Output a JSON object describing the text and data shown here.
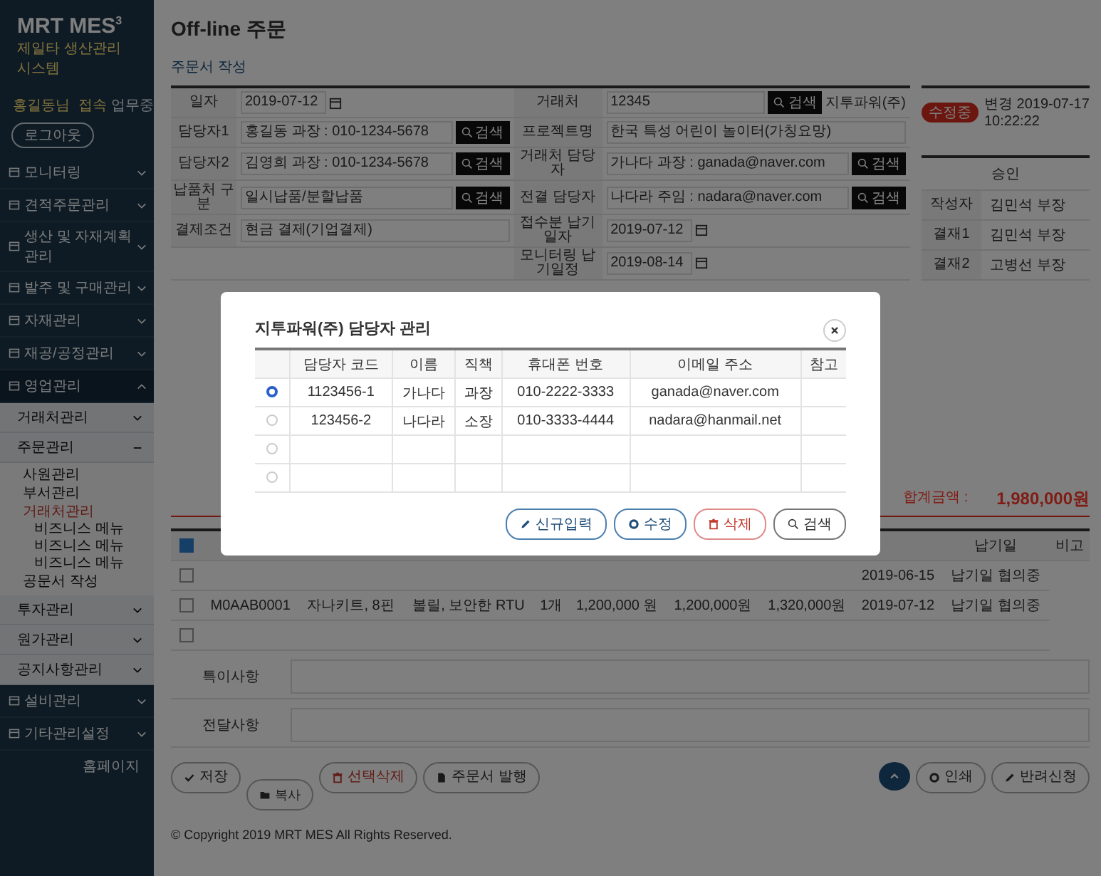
{
  "sidebar": {
    "logo": "MRT MES",
    "logo_sup": "3",
    "subtitle": "제일타 생산관리 시스템",
    "user": "홍길동님",
    "status": "접속",
    "status_extra": "업무중",
    "logout": "로그아웃",
    "menu": [
      {
        "label": "모니터링",
        "expanded": false
      },
      {
        "label": "견적주문관리",
        "expanded": false
      },
      {
        "label": "생산 및 자재계획관리",
        "expanded": false
      },
      {
        "label": "발주 및 구매관리",
        "expanded": false
      },
      {
        "label": "자재관리",
        "expanded": false
      },
      {
        "label": "재공/공정관리",
        "expanded": false
      },
      {
        "label": "영업관리",
        "expanded": true,
        "children": [
          {
            "label": "거래처관리",
            "expanded": false
          },
          {
            "label": "주문관리",
            "expanded": true,
            "children": [
              {
                "label": "사원관리",
                "selected": false
              },
              {
                "label": "부서관리",
                "selected": false
              },
              {
                "label": "거래처관리",
                "selected": true,
                "children": [
                  {
                    "label": "비즈니스 메뉴"
                  },
                  {
                    "label": "비즈니스 메뉴"
                  },
                  {
                    "label": "비즈니스 메뉴"
                  }
                ]
              },
              {
                "label": "공문서 작성",
                "selected": false
              }
            ]
          },
          {
            "label": "투자관리",
            "expanded": false
          },
          {
            "label": "원가관리",
            "expanded": false
          },
          {
            "label": "공지사항관리",
            "expanded": false
          }
        ]
      },
      {
        "label": "설비관리",
        "expanded": false
      },
      {
        "label": "기타관리설정",
        "expanded": false
      }
    ],
    "footer_link": "홈페이지"
  },
  "page": {
    "title": "Off-line 주문",
    "section": "주문서 작성"
  },
  "form": {
    "rows": [
      {
        "left": {
          "label": "일자",
          "kind": "date",
          "value": "2019-07-12"
        },
        "right": {
          "label": "거래처",
          "kind": "search",
          "value": "12345",
          "button": "검색",
          "note": "지투파워(주)"
        }
      },
      {
        "left": {
          "label": "담당자1",
          "kind": "search",
          "value": "홍길동 과장 : 010-1234-5678",
          "button": "검색"
        },
        "right": {
          "label": "프로젝트명",
          "kind": "text",
          "value": "한국 특성 어린이 놀이터(가칭요망)"
        }
      },
      {
        "left": {
          "label": "담당자2",
          "kind": "search",
          "value": "김영희 과장 : 010-1234-5678",
          "button": "검색"
        },
        "right": {
          "label": "거래처 담당자",
          "kind": "search",
          "value": "가나다 과장 : ganada@naver.com",
          "button": "검색"
        }
      },
      {
        "left": {
          "label": "납품처 구분",
          "kind": "search",
          "value": "일시납품/분할납품",
          "button": "검색"
        },
        "right": {
          "label": "전결 담당자",
          "kind": "search",
          "value": "나다라 주임 : nadara@naver.com",
          "button": "검색"
        }
      },
      {
        "left": {
          "label": "결제조건",
          "kind": "text",
          "value": "현금 결제(기업결제)"
        },
        "right": {
          "label": "접수분 납기일자",
          "kind": "date",
          "value": "2019-07-12"
        }
      },
      {
        "left": {
          "kind": "blank"
        },
        "right": {
          "label": "모니터링 납기일정",
          "kind": "date",
          "value": "2019-08-14"
        }
      }
    ]
  },
  "status": {
    "badge": "수정중",
    "changed": "변경 2019-07-17 10:22:22"
  },
  "approval": {
    "title": "승인",
    "rows": [
      {
        "role": "작성자",
        "name": "김민석 부장"
      },
      {
        "role": "결재1",
        "name": "김민석 부장"
      },
      {
        "role": "결재2",
        "name": "고병선 부장"
      }
    ]
  },
  "total": {
    "label": "합계금액 :",
    "value": "1,980,000원"
  },
  "items": {
    "all_checked": true,
    "columns": [
      {},
      {},
      {},
      {},
      {},
      {},
      {},
      {},
      {
        "label": "납기일"
      },
      {
        "label": "비고"
      }
    ],
    "rows": [
      {
        "checked": false,
        "cells": [
          {},
          {},
          {},
          {},
          {},
          {},
          {},
          {
            "text": "2019-06-15"
          },
          {
            "text": "납기일 협의중"
          }
        ]
      },
      {
        "checked": false,
        "cells": [
          {
            "text": "M0AAB0001"
          },
          {
            "text": "자나키트, 8핀"
          },
          {
            "text": "볼릴, 보안한 RTU"
          },
          {
            "text": "1개"
          },
          {
            "text": "1,200,000 원"
          },
          {
            "text": "1,200,000원"
          },
          {
            "text": "1,320,000원"
          },
          {
            "text": "2019-07-12"
          },
          {
            "text": "납기일 협의중"
          }
        ]
      },
      {
        "checked": false,
        "cells": [
          {},
          {},
          {},
          {},
          {},
          {},
          {},
          {},
          {}
        ]
      }
    ]
  },
  "notes": [
    {
      "label": "특이사항"
    },
    {
      "label": "전달사항"
    }
  ],
  "actions": {
    "left": [
      {
        "label": "저장",
        "kind": "save"
      },
      {
        "label": "복사",
        "kind": "copy"
      },
      {
        "label": "선택삭제",
        "kind": "delete"
      },
      {
        "label": "주문서 발행",
        "kind": "publish"
      }
    ],
    "right": [
      {
        "label": "인쇄",
        "kind": "print"
      },
      {
        "label": "반려신청",
        "kind": "edit"
      }
    ]
  },
  "copyright": "© Copyright 2019 MRT MES All Rights Reserved.",
  "modal": {
    "title": "지투파워(주) 담당자 관리",
    "columns": [
      {
        "label": "담당자 코드"
      },
      {
        "label": "이름"
      },
      {
        "label": "직책"
      },
      {
        "label": "휴대폰 번호"
      },
      {
        "label": "이메일 주소"
      },
      {
        "label": "참고"
      }
    ],
    "rows": [
      {
        "selected": true,
        "code": "1123456-1",
        "name": "가나다",
        "position": "과장",
        "phone": "010-2222-3333",
        "email": "ganada@naver.com"
      },
      {
        "selected": false,
        "code": "123456-2",
        "name": "나다라",
        "position": "소장",
        "phone": "010-3333-4444",
        "email": "nadara@hanmail.net"
      },
      {
        "selected": false
      },
      {
        "selected": false
      }
    ],
    "buttons": [
      {
        "label": "신규입력",
        "kind": "new"
      },
      {
        "label": "수정",
        "kind": "modify"
      },
      {
        "label": "삭제",
        "kind": "delete"
      },
      {
        "label": "검색",
        "kind": "search"
      }
    ]
  }
}
